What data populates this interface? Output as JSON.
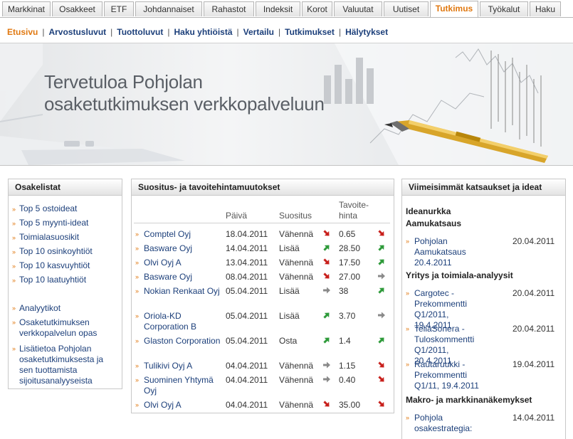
{
  "tabs": [
    "Markkinat",
    "Osakkeet",
    "ETF",
    "Johdannaiset",
    "Rahastot",
    "Indeksit",
    "Korot",
    "Valuutat",
    "Uutiset",
    "Tutkimus",
    "Työkalut",
    "Haku"
  ],
  "active_tab": "Tutkimus",
  "subnav": [
    "Etusivu",
    "Arvostusluvut",
    "Tuottoluvut",
    "Haku yhtiöistä",
    "Vertailu",
    "Tutkimukset",
    "Hälytykset"
  ],
  "banner": {
    "line1": "Tervetuloa Pohjolan",
    "line2": "osaketutkimuksen verkkopalveluun"
  },
  "osakelistat": {
    "title": "Osakelistat",
    "lists": [
      "Top 5 ostoideat",
      "Top 5 myynti-ideat",
      "Toimialasuosikit",
      "Top 10 osinkoyhtiöt",
      "Top 10 kasvuyhtiöt",
      "Top 10 laatuyhtiöt"
    ],
    "links": [
      "Analyytikot",
      "Osaketutkimuksen verkkopalvelun opas",
      "Lisätietoa Pohjolan osaketutkimuksesta ja sen tuottamista sijoitusanalyyseista"
    ]
  },
  "suositus": {
    "title": "Suositus- ja tavoitehintamuutokset",
    "headers": {
      "date": "Päivä",
      "rec": "Suositus",
      "target": "Tavoite-\nhinta"
    },
    "rows": [
      {
        "company": "Comptel Oyj",
        "date": "18.04.2011",
        "rec": "Vähennä",
        "rec_dir": "down",
        "target": "0.65",
        "target_dir": "down"
      },
      {
        "company": "Basware Oyj",
        "date": "14.04.2011",
        "rec": "Lisää",
        "rec_dir": "up",
        "target": "28.50",
        "target_dir": "up"
      },
      {
        "company": "Olvi Oyj A",
        "date": "13.04.2011",
        "rec": "Vähennä",
        "rec_dir": "down",
        "target": "17.50",
        "target_dir": "up"
      },
      {
        "company": "Basware Oyj",
        "date": "08.04.2011",
        "rec": "Vähennä",
        "rec_dir": "down",
        "target": "27.00",
        "target_dir": "right"
      },
      {
        "company": "Nokian Renkaat Oyj",
        "date": "05.04.2011",
        "rec": "Lisää",
        "rec_dir": "right",
        "target": "38",
        "target_dir": "up"
      },
      {
        "company": "Oriola-KD Corporation B",
        "date": "05.04.2011",
        "rec": "Lisää",
        "rec_dir": "up",
        "target": "3.70",
        "target_dir": "right"
      },
      {
        "company": "Glaston Corporation",
        "date": "05.04.2011",
        "rec": "Osta",
        "rec_dir": "up",
        "target": "1.4",
        "target_dir": "up"
      },
      {
        "company": "Tulikivi Oyj A",
        "date": "04.04.2011",
        "rec": "Vähennä",
        "rec_dir": "right",
        "target": "1.15",
        "target_dir": "down"
      },
      {
        "company": "Suominen Yhtymä Oyj",
        "date": "04.04.2011",
        "rec": "Vähennä",
        "rec_dir": "right",
        "target": "0.40",
        "target_dir": "down"
      },
      {
        "company": "Olvi Oyj A",
        "date": "04.04.2011",
        "rec": "Vähennä",
        "rec_dir": "down",
        "target": "35.00",
        "target_dir": "down"
      }
    ]
  },
  "viimeisimmat": {
    "title": "Viimeisimmät katsaukset ja ideat",
    "sections": [
      {
        "heading": "Ideanurkka",
        "items": []
      },
      {
        "heading": "Aamukatsaus",
        "items": [
          {
            "text": "Pohjolan Aamukatsaus 20.4.2011",
            "date": "20.04.2011"
          }
        ]
      },
      {
        "heading": "Yritys ja toimiala-analyysit",
        "items": [
          {
            "text": "Cargotec - Prekommentti Q1/2011, 19.4.2011",
            "date": "20.04.2011"
          },
          {
            "text": "TeliaSonera - Tuloskommentti Q1/2011, 20.4.2011",
            "date": "20.04.2011"
          },
          {
            "text": "Rautaruukki - Prekommentti Q1/11, 19.4.2011",
            "date": "19.04.2011"
          }
        ]
      },
      {
        "heading": "Makro- ja markkinanäkemykset",
        "items": [
          {
            "text": "Pohjola osakestrategia:",
            "date": "14.04.2011"
          }
        ]
      }
    ]
  }
}
